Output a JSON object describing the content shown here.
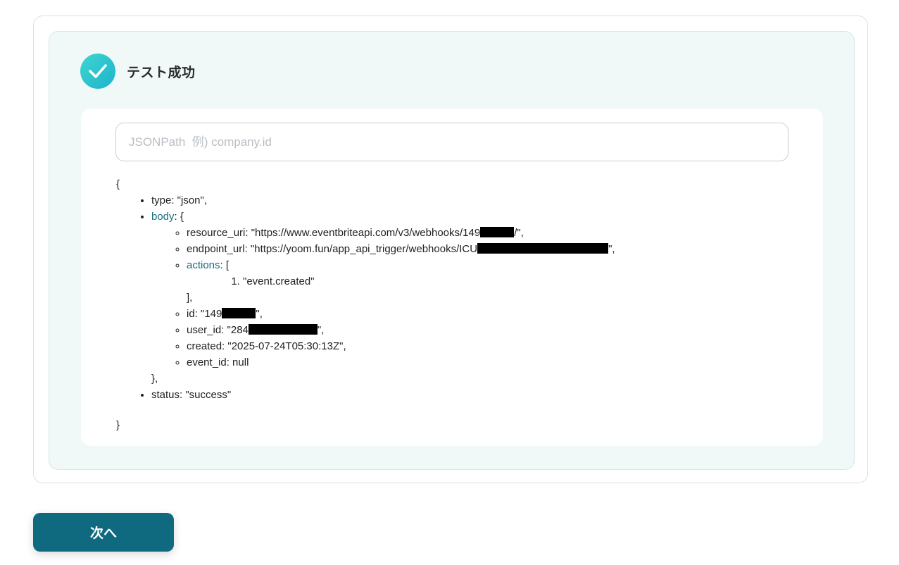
{
  "result": {
    "title": "テスト成功",
    "icon": "check-icon"
  },
  "search": {
    "placeholder": "JSONPath  例) company.id",
    "value": ""
  },
  "json": {
    "open_brace": "{",
    "close_brace": "}",
    "type_line": "type: \"json\",",
    "body_key": "body",
    "body_open": ": {",
    "resource_uri_prefix": "resource_uri: \"https://www.eventbriteapi.com/v3/webhooks/149",
    "resource_uri_suffix": "/\",",
    "endpoint_url_prefix": "endpoint_url: \"https://yoom.fun/app_api_trigger/webhooks/ICU",
    "endpoint_url_suffix": "\",",
    "actions_key": "actions",
    "actions_open": ": [",
    "actions_item": "\"event.created\"",
    "actions_close": "],",
    "id_prefix": "id: \"149",
    "id_suffix": "\",",
    "user_id_prefix": "user_id: \"284",
    "user_id_suffix": "\",",
    "created_line": "created: \"2025-07-24T05:30:13Z\",",
    "event_id_line": "event_id: null",
    "body_close": "},",
    "status_line": "status: \"success\""
  },
  "footer": {
    "next_label": "次へ"
  },
  "colors": {
    "accent": "#0f6a80",
    "success_gradient_start": "#3fd6d0",
    "success_gradient_end": "#1cb3cc",
    "panel_bg": "#f1f9f8",
    "json_key_link": "#1a6b82"
  }
}
